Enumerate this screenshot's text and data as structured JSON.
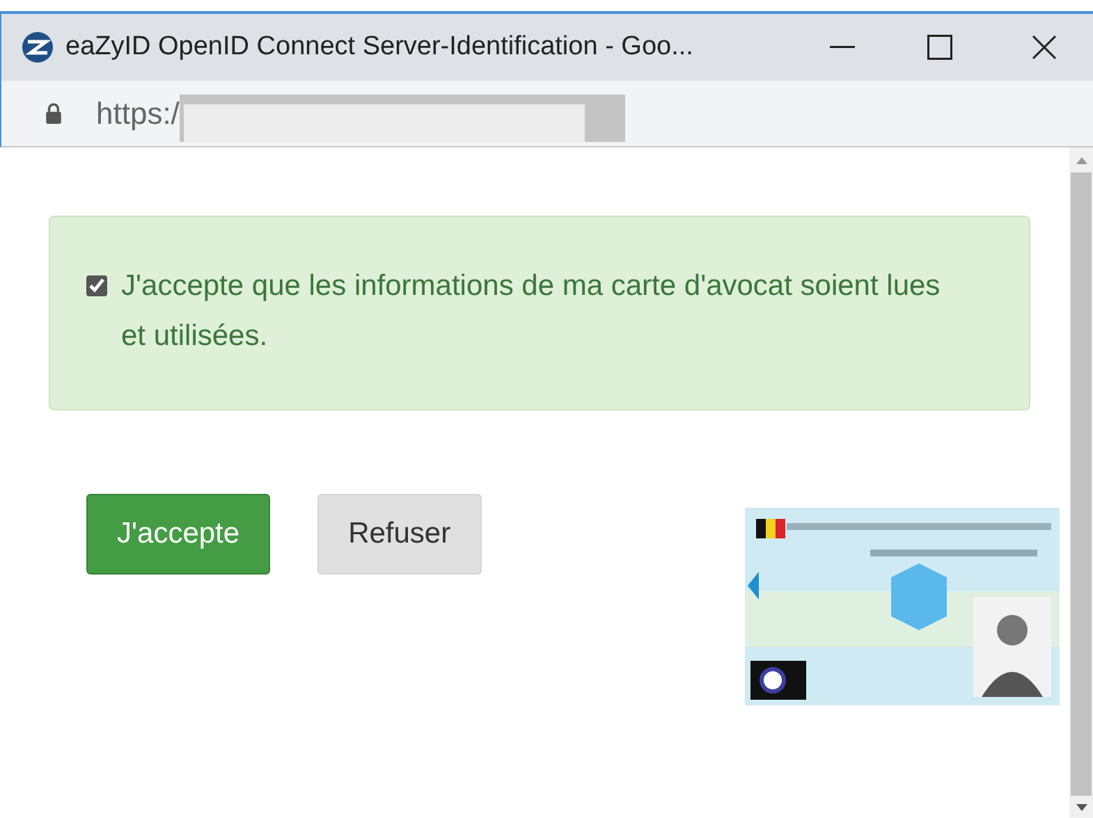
{
  "window": {
    "title": "eaZyID OpenID Connect Server-Identification - Goo..."
  },
  "address_bar": {
    "url": "https:/",
    "redacted": true
  },
  "consent": {
    "checked": true,
    "text": "J'accepte que les informations de ma carte d'avocat soient lues et utilisées."
  },
  "buttons": [
    {
      "kind": "primary",
      "label": "J'accepte"
    },
    {
      "kind": "secondary",
      "label": "Refuser"
    }
  ]
}
